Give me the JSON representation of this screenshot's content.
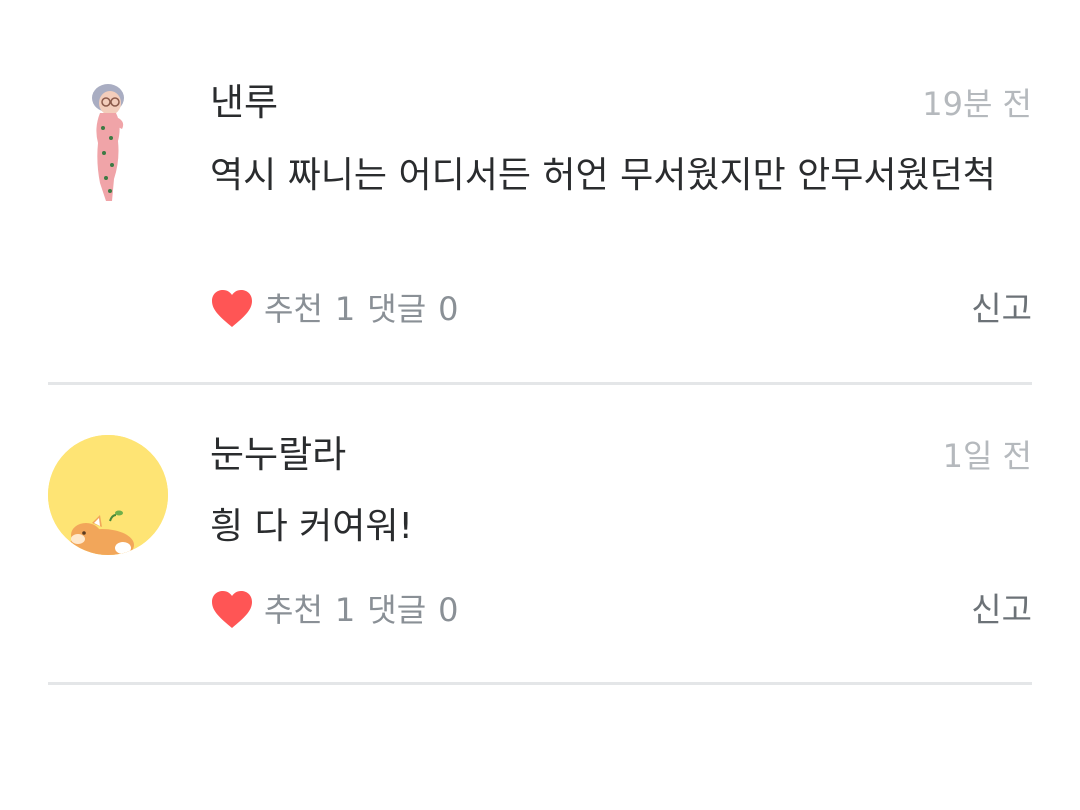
{
  "comments": [
    {
      "author": "낸루",
      "time": "19분 전",
      "text": "역시 짜니는 어디서든 허언 무서웠지만 안무서웠던척",
      "like_label": "추천",
      "like_count": "1",
      "reply_label": "댓글",
      "reply_count": "0",
      "report_label": "신고",
      "avatar_icon": "character-avatar-icon",
      "heart_color": "#ff5555"
    },
    {
      "author": "눈누랄라",
      "time": "1일 전",
      "text": "힁 다 커여워!",
      "like_label": "추천",
      "like_count": "1",
      "reply_label": "댓글",
      "reply_count": "0",
      "report_label": "신고",
      "avatar_icon": "dog-avatar-icon",
      "avatar_bg": "#fee474",
      "heart_color": "#ff5555"
    }
  ]
}
